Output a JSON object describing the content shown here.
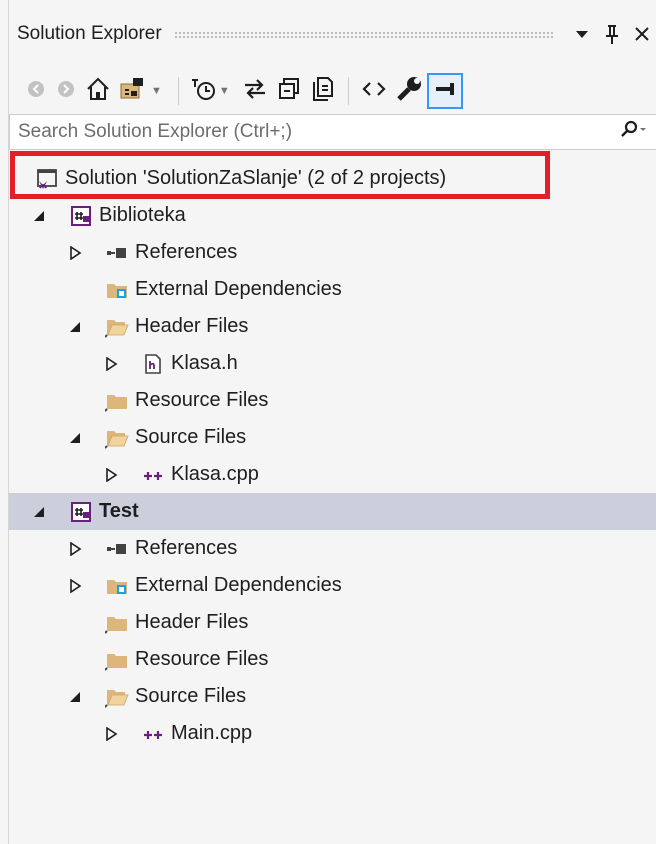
{
  "panel": {
    "title": "Solution Explorer",
    "search_placeholder": "Search Solution Explorer (Ctrl+;)"
  },
  "toolbar": {
    "buttons": [
      "back-icon",
      "forward-icon",
      "home-icon",
      "switch-views-icon",
      "pending-changes-icon",
      "sync-icon",
      "collapse-all-icon",
      "show-all-files-icon",
      "view-code-icon",
      "properties-icon",
      "preview-icon"
    ]
  },
  "tree": {
    "solution": "Solution 'SolutionZaSlanje' (2 of 2 projects)",
    "projects": [
      {
        "name": "Biblioteka",
        "items": [
          {
            "label": "References"
          },
          {
            "label": "External Dependencies"
          },
          {
            "label": "Header Files",
            "children": [
              {
                "label": "Klasa.h"
              }
            ]
          },
          {
            "label": "Resource Files"
          },
          {
            "label": "Source Files",
            "children": [
              {
                "label": "Klasa.cpp"
              }
            ]
          }
        ]
      },
      {
        "name": "Test",
        "items": [
          {
            "label": "References"
          },
          {
            "label": "External Dependencies"
          },
          {
            "label": "Header Files"
          },
          {
            "label": "Resource Files"
          },
          {
            "label": "Source Files",
            "children": [
              {
                "label": "Main.cpp"
              }
            ]
          }
        ]
      }
    ]
  },
  "colors": {
    "highlight_border": "#e41d2a",
    "selected_row": "#cccedb",
    "accent": "#3399ff",
    "folder": "#dcb67a",
    "project_purple": "#68217a"
  }
}
